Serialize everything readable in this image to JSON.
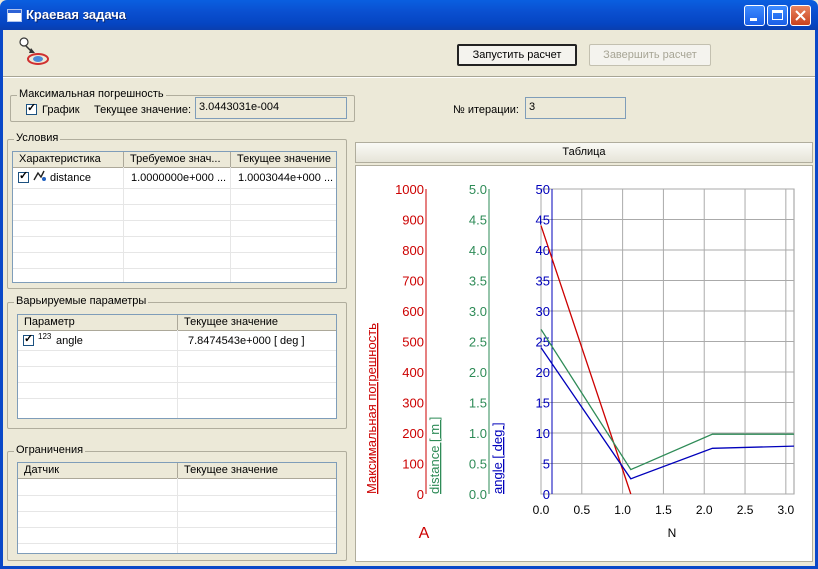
{
  "window": {
    "title": "Краевая задача"
  },
  "toolbar": {
    "run_label": "Запустить расчет",
    "stop_label": "Завершить расчет"
  },
  "max_error": {
    "group_label": "Максимальная погрешность",
    "chart_checkbox_label": "График",
    "current_label": "Текущее значение:",
    "current_value": "3.0443031e-004"
  },
  "iteration": {
    "label": "№ итерации:",
    "value": "3"
  },
  "conditions": {
    "group_label": "Условия",
    "columns": [
      "Характеристика",
      "Требуемое знач...",
      "Текущее значение"
    ],
    "rows": [
      {
        "name": "distance",
        "required": "1.0000000e+000 ...",
        "current": "1.0003044e+000 ..."
      }
    ]
  },
  "params": {
    "group_label": "Варьируемые параметры",
    "columns": [
      "Параметр",
      "Текущее значение"
    ],
    "rows": [
      {
        "name": "angle",
        "value": "7.8474543e+000  [ deg ]"
      }
    ]
  },
  "constraints": {
    "group_label": "Ограничения",
    "columns": [
      "Датчик",
      "Текущее значение"
    ]
  },
  "tab": {
    "label": "Таблица"
  },
  "chart_data": {
    "type": "line",
    "xlabel": "N",
    "x_ticks": [
      "0.0",
      "0.5",
      "1.0",
      "1.5",
      "2.0",
      "2.5",
      "3.0"
    ],
    "xlim": [
      0,
      3.1
    ],
    "extra_label": "A",
    "axes": [
      {
        "label": "Максимальная погрешность",
        "color": "#cc0000",
        "ylim": [
          0,
          1000
        ],
        "ticks": [
          "0",
          "100",
          "200",
          "300",
          "400",
          "500",
          "600",
          "700",
          "800",
          "900",
          "1000"
        ]
      },
      {
        "label": "distance  [ m ]",
        "color": "#2e8b57",
        "ylim": [
          0,
          5
        ],
        "ticks": [
          "0.0",
          "0.5",
          "1.0",
          "1.5",
          "2.0",
          "2.5",
          "3.0",
          "3.5",
          "4.0",
          "4.5",
          "5.0"
        ]
      },
      {
        "label": "angle  [ deg ]",
        "color": "#0000bb",
        "ylim": [
          0,
          50
        ],
        "ticks": [
          "0",
          "5",
          "10",
          "15",
          "20",
          "25",
          "30",
          "35",
          "40",
          "45",
          "50"
        ]
      }
    ],
    "series": [
      {
        "axis": 0,
        "color": "#cc0000",
        "x": [
          0,
          1.1
        ],
        "y": [
          880,
          0
        ]
      },
      {
        "axis": 1,
        "color": "#2e8b57",
        "x": [
          0,
          1.1,
          2.1,
          3.1
        ],
        "y": [
          2.7,
          0.4,
          0.98,
          0.98
        ]
      },
      {
        "axis": 2,
        "color": "#0000bb",
        "x": [
          0,
          1.1,
          2.1,
          3.1
        ],
        "y": [
          24,
          2.5,
          7.5,
          7.85
        ]
      }
    ]
  }
}
